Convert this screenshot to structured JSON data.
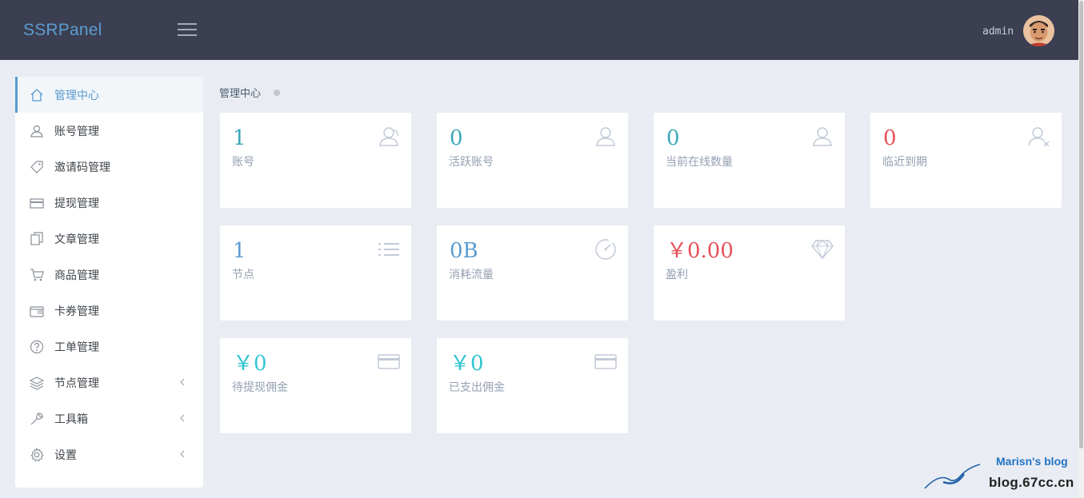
{
  "header": {
    "brand": "SSRPanel",
    "username": "admin"
  },
  "sidebar": {
    "items": [
      {
        "label": "管理中心",
        "icon": "home-icon",
        "active": true
      },
      {
        "label": "账号管理",
        "icon": "users-icon"
      },
      {
        "label": "邀请码管理",
        "icon": "tag-icon"
      },
      {
        "label": "提现管理",
        "icon": "credit-card-icon"
      },
      {
        "label": "文章管理",
        "icon": "docs-icon"
      },
      {
        "label": "商品管理",
        "icon": "cart-icon"
      },
      {
        "label": "卡券管理",
        "icon": "wallet-icon"
      },
      {
        "label": "工单管理",
        "icon": "question-icon"
      },
      {
        "label": "节点管理",
        "icon": "layers-icon",
        "expandable": true
      },
      {
        "label": "工具箱",
        "icon": "wrench-icon",
        "expandable": true
      },
      {
        "label": "设置",
        "icon": "settings-icon",
        "expandable": true
      }
    ]
  },
  "breadcrumb": {
    "current": "管理中心"
  },
  "stats": [
    {
      "value": "1",
      "label": "账号",
      "icon": "users-icon",
      "color": "#3aa8b8"
    },
    {
      "value": "0",
      "label": "活跃账号",
      "icon": "user-icon",
      "color": "#3aa8b8"
    },
    {
      "value": "0",
      "label": "当前在线数量",
      "icon": "user-icon",
      "color": "#3aa8b8"
    },
    {
      "value": "0",
      "label": "临近到期",
      "icon": "user-unfollow-icon",
      "color": "#e7505a"
    },
    {
      "value": "1",
      "label": "节点",
      "icon": "list-icon",
      "color": "#5c9bd1"
    },
    {
      "value": "0B",
      "label": "消耗流量",
      "icon": "speedometer-icon",
      "color": "#5c9bd1"
    },
    {
      "value": "￥0.00",
      "label": "盈利",
      "icon": "diamond-icon",
      "color": "#e7505a"
    },
    {
      "value": "￥0",
      "label": "待提现佣金",
      "icon": "credit-card-icon",
      "color": "#32c5d2"
    },
    {
      "value": "￥0",
      "label": "已支出佣金",
      "icon": "credit-card-icon",
      "color": "#32c5d2"
    }
  ],
  "watermark": {
    "title": "Marisn's blog",
    "url": "blog.67cc.cn"
  },
  "colors": {
    "topbar": "#3b3f51",
    "brand": "#5c9bd1",
    "background": "#e9ecf3",
    "accent": "#5b9bd1"
  }
}
